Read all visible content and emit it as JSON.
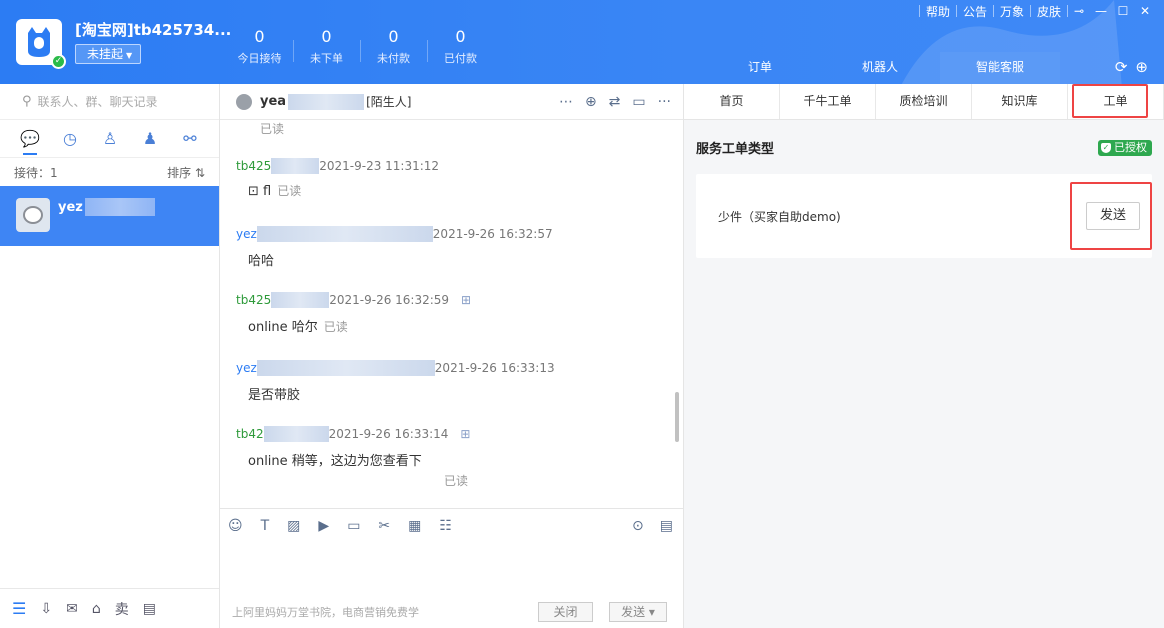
{
  "header": {
    "store_name": "[淘宝网]tb425734...",
    "status": "未挂起",
    "stats": [
      {
        "value": "0",
        "label": "今日接待"
      },
      {
        "value": "0",
        "label": "未下单"
      },
      {
        "value": "0",
        "label": "未付款"
      },
      {
        "value": "0",
        "label": "已付款"
      }
    ],
    "sys_menu": [
      "帮助",
      "公告",
      "万象",
      "皮肤"
    ],
    "tabs": [
      "订单",
      "机器人",
      "智能客服"
    ]
  },
  "sidebar": {
    "search_placeholder": "联系人、群、聊天记录",
    "waiting_label": "接待：1",
    "sort_label": "排序 ⇅",
    "conversation_name": "yez"
  },
  "chat": {
    "contact_name": "yea",
    "contact_tag": "[陌生人]",
    "first_read": "已读",
    "messages": [
      {
        "who": "tb425",
        "time": "2021-9-23 11:31:12",
        "text": "fl",
        "read": "已读"
      },
      {
        "who": "yez",
        "time": "2021-9-26 16:32:57",
        "text": "哈哈",
        "read": ""
      },
      {
        "who": "tb425",
        "time": "2021-9-26 16:32:59",
        "text": "online 哈尔",
        "read": "已读"
      },
      {
        "who": "yez",
        "time": "2021-9-26 16:33:13",
        "text": "是否带胶",
        "read": ""
      },
      {
        "who": "tb42",
        "time": "2021-9-26 16:33:14",
        "text": "online 稍等，这边为您查看下",
        "read": "已读"
      }
    ],
    "footer_ad": "上阿里妈妈万堂书院，电商营销免费学",
    "close_label": "关闭",
    "send_label": "发送 ▾"
  },
  "right": {
    "tabs": [
      "首页",
      "千牛工单",
      "质检培训",
      "知识库",
      "工单"
    ],
    "section_title": "服务工单类型",
    "auth_label": "已授权",
    "card_text": "少件（买家自助demo)",
    "card_button": "发送"
  },
  "colors": {
    "brand_blue": "#2c7cf3",
    "seller_green": "#2e9a3a",
    "highlight_red": "#e44444"
  }
}
